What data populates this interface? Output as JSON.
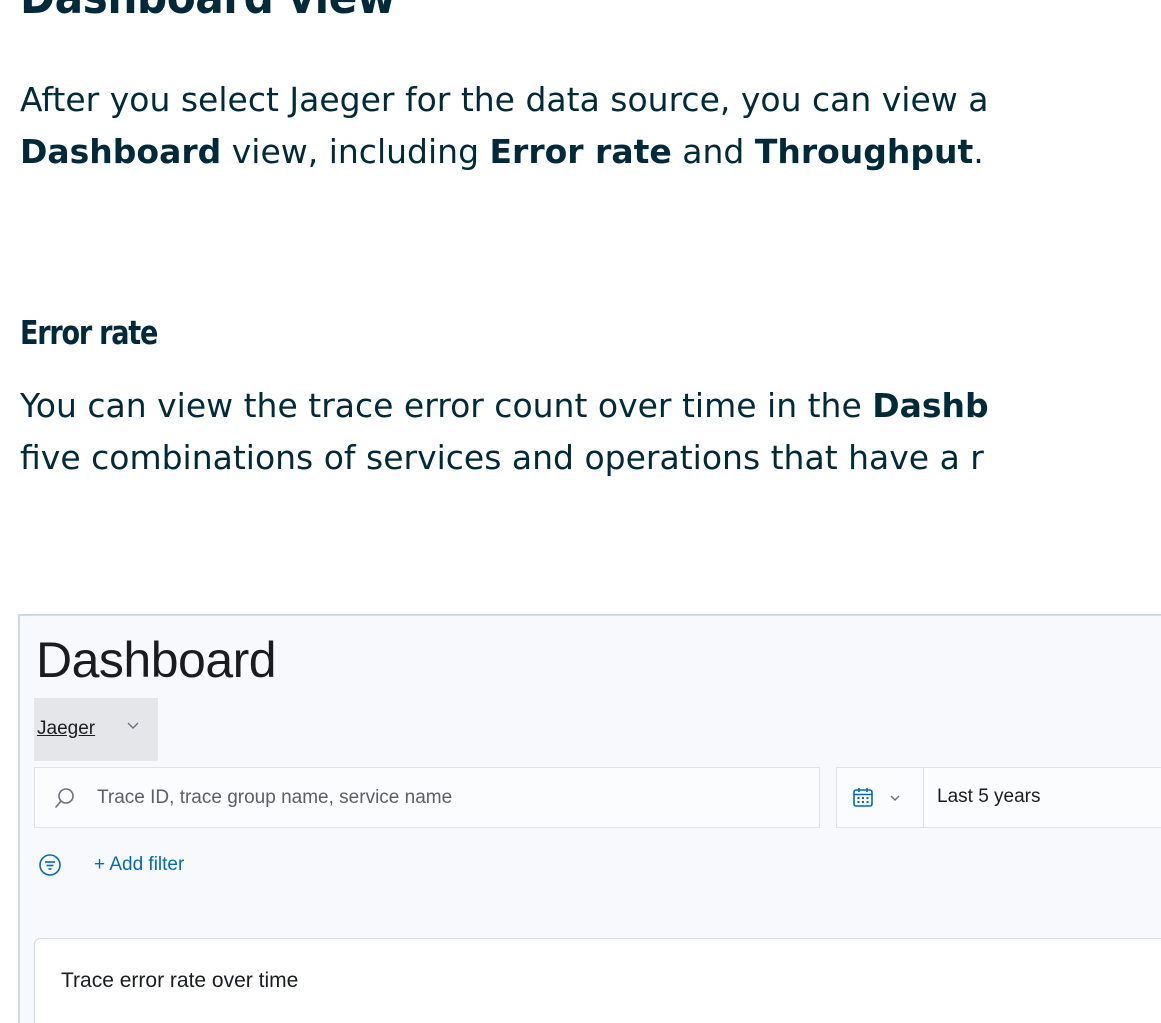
{
  "doc": {
    "heading": "Dashboard view",
    "intro": {
      "line1": "After you select Jaeger for the data source, you can view a",
      "line2_bold1": "Dashboard",
      "line2_text1": " view, including ",
      "line2_bold2": "Error rate",
      "line2_text2": " and ",
      "line2_bold3": "Throughput",
      "line2_text3": "."
    },
    "subheading": "Error rate",
    "error_rate": {
      "line1_text": "You can view the trace error count over time in the ",
      "line1_bold": "Dashb",
      "line2": "five combinations of services and operations that have a r"
    }
  },
  "screenshot": {
    "title": "Dashboard",
    "data_source": "Jaeger",
    "search": {
      "placeholder": "Trace ID, trace group name, service name",
      "value": ""
    },
    "date_range": "Last 5 years",
    "add_filter": "+ Add filter",
    "panel_title": "Trace error rate over time",
    "colors": {
      "link": "#006bb8",
      "text": "#1a1c21",
      "background": "#f7f9fc",
      "doc_text": "#002a3a"
    },
    "icons": [
      "search-icon",
      "calendar-icon",
      "chevron-down-icon",
      "filter-icon"
    ]
  }
}
